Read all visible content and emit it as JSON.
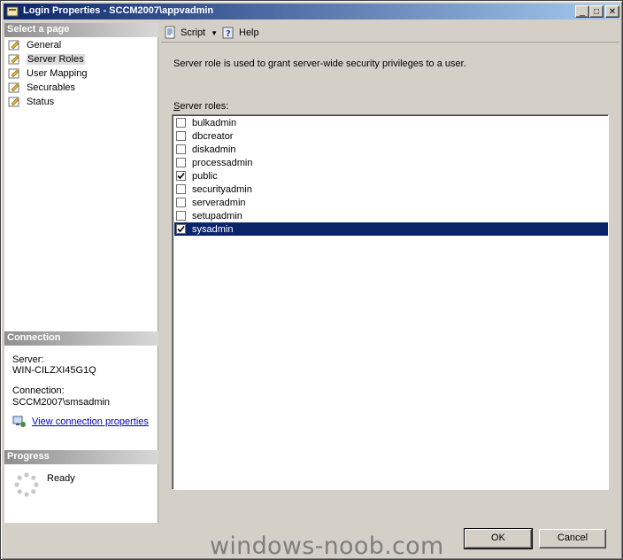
{
  "window": {
    "title": "Login Properties - SCCM2007\\appvadmin"
  },
  "left": {
    "select_header": "Select a page",
    "pages": [
      {
        "label": "General"
      },
      {
        "label": "Server Roles"
      },
      {
        "label": "User Mapping"
      },
      {
        "label": "Securables"
      },
      {
        "label": "Status"
      }
    ],
    "connection_header": "Connection",
    "server_label": "Server:",
    "server_value": "WIN-CILZXI45G1Q",
    "connection_label": "Connection:",
    "connection_value": "SCCM2007\\smsadmin",
    "view_link": "View connection properties",
    "progress_header": "Progress",
    "progress_status": "Ready"
  },
  "toolbar": {
    "script_label": "Script",
    "help_label": "Help"
  },
  "main": {
    "description": "Server role is used to grant server-wide security privileges to a user.",
    "roles_label_first": "S",
    "roles_label_rest": "erver roles:",
    "roles": [
      {
        "name": "bulkadmin",
        "checked": false
      },
      {
        "name": "dbcreator",
        "checked": false
      },
      {
        "name": "diskadmin",
        "checked": false
      },
      {
        "name": "processadmin",
        "checked": false
      },
      {
        "name": "public",
        "checked": true
      },
      {
        "name": "securityadmin",
        "checked": false
      },
      {
        "name": "serveradmin",
        "checked": false
      },
      {
        "name": "setupadmin",
        "checked": false
      },
      {
        "name": "sysadmin",
        "checked": true
      }
    ],
    "selected_role": "sysadmin"
  },
  "buttons": {
    "ok": "OK",
    "cancel": "Cancel"
  },
  "watermark": "windows-noob.com"
}
